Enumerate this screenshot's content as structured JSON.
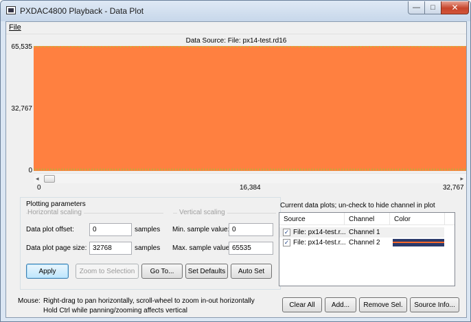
{
  "window": {
    "title": "PXDAC4800 Playback - Data Plot",
    "minimize_glyph": "—",
    "maximize_glyph": "□",
    "close_glyph": "✕"
  },
  "menu": {
    "file": "File"
  },
  "plot": {
    "source_title": "Data Source: File: px14-test.rd16",
    "y_ticks": [
      "65,535",
      "32,767",
      "0"
    ],
    "x_ticks": [
      "0",
      "16,384",
      "32,767"
    ],
    "fill_color": "#ff8040",
    "scroll_left_glyph": "◂",
    "scroll_right_glyph": "▸"
  },
  "plotting": {
    "title": "Plotting parameters",
    "horizontal_heading": "Horizontal scaling",
    "vertical_heading": "Vertical scaling",
    "offset_label": "Data plot offset:",
    "offset_value": "0",
    "offset_units": "samples",
    "page_size_label": "Data plot page size:",
    "page_size_value": "32768",
    "page_size_units": "samples",
    "min_label": "Min. sample value:",
    "min_value": "0",
    "max_label": "Max. sample value:",
    "max_value": "65535",
    "buttons": {
      "apply": "Apply",
      "zoom": "Zoom to Selection",
      "goto": "Go To...",
      "defaults": "Set Defaults",
      "autoset": "Auto Set"
    }
  },
  "plots_list": {
    "title": "Current data plots; un-check to hide channel in plot",
    "columns": [
      "Source",
      "Channel",
      "Color"
    ],
    "rows": [
      {
        "source": "File: px14-test.r...",
        "channel": "Channel 1",
        "checked": "✓"
      },
      {
        "source": "File: px14-test.r...",
        "channel": "Channel 2",
        "checked": "✓"
      }
    ],
    "row2_colors": [
      "#2b3a6b",
      "#ff6a2a"
    ]
  },
  "footer": {
    "mouse_label": "Mouse:",
    "line1": "Right-drag to pan horizontally, scroll-wheel to zoom in-out horizontally",
    "line2": "Hold Ctrl while panning/zooming affects vertical",
    "buttons": {
      "clear_all": "Clear All",
      "add": "Add...",
      "remove": "Remove Sel.",
      "source_info": "Source Info..."
    }
  }
}
